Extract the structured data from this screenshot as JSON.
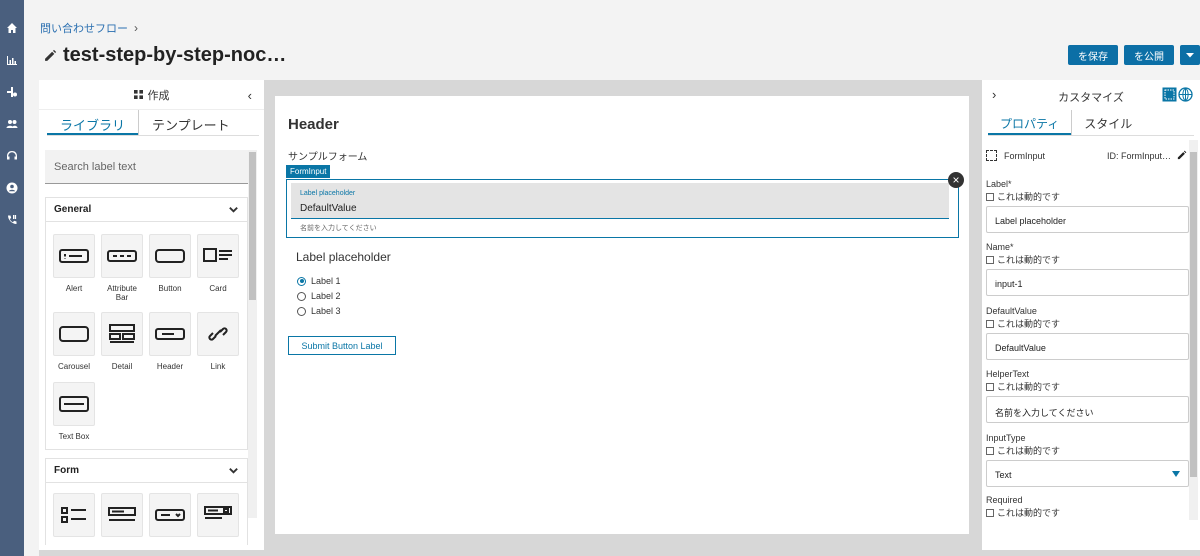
{
  "breadcrumb": {
    "parent": "問い合わせフロー",
    "chevron": "›"
  },
  "page": {
    "title": "test-step-by-step-noc…"
  },
  "actions": {
    "save": "を保存",
    "publish": "を公開"
  },
  "rail_icons": [
    "home-icon",
    "chart-icon",
    "flow-icon",
    "users-icon",
    "headset-icon",
    "account-icon",
    "phone-icon"
  ],
  "library": {
    "title": "作成",
    "collapse": "‹",
    "tabs": [
      "ライブラリ",
      "テンプレート"
    ],
    "search_placeholder": "Search label text",
    "categories": [
      {
        "name": "General",
        "items": [
          "Alert",
          "Attribute Bar",
          "Button",
          "Card",
          "Carousel",
          "Detail",
          "Header",
          "Link",
          "Text Box"
        ]
      },
      {
        "name": "Form"
      }
    ]
  },
  "canvas": {
    "header": "Header",
    "subtitle": "サンプルフォーム",
    "form_input": {
      "tag": "FormInput",
      "label_placeholder": "Label placeholder",
      "value": "DefaultValue",
      "helper": "名前を入力してください",
      "close": "×"
    },
    "radio_group": {
      "label": "Label placeholder",
      "options": [
        "Label 1",
        "Label 2",
        "Label 3"
      ],
      "selected": 0
    },
    "submit_label": "Submit Button Label"
  },
  "props": {
    "chevron": "›",
    "title": "カスタマイズ",
    "tabs": [
      "プロパティ",
      "スタイル"
    ],
    "component_name": "FormInput",
    "component_id": "ID: FormInput…",
    "dynamic_label": "これは動的です",
    "fields": [
      {
        "name": "Label*",
        "value": "Label placeholder"
      },
      {
        "name": "Name*",
        "value": "input-1"
      },
      {
        "name": "DefaultValue",
        "value": "DefaultValue"
      },
      {
        "name": "HelperText",
        "value": "名前を入力してください"
      },
      {
        "name": "InputType",
        "value": "Text"
      },
      {
        "name": "Required"
      }
    ]
  },
  "colors": {
    "accent": "#0a76a6",
    "rail": "#4a5f7e",
    "workspace": "#d7d7d7"
  }
}
